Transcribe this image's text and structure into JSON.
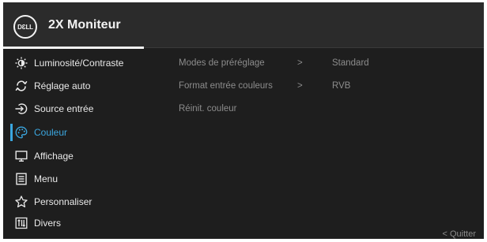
{
  "header": {
    "logo_text": "DƐLL",
    "title": "2X Moniteur"
  },
  "menu": {
    "items": [
      {
        "label": "Luminosité/Contraste",
        "icon": "brightness-icon"
      },
      {
        "label": "Réglage auto",
        "icon": "auto-adjust-icon"
      },
      {
        "label": "Source entrée",
        "icon": "input-source-icon"
      },
      {
        "label": "Couleur",
        "icon": "color-palette-icon",
        "selected": true
      },
      {
        "label": "Affichage",
        "icon": "display-icon"
      },
      {
        "label": "Menu",
        "icon": "menu-icon"
      },
      {
        "label": "Personnaliser",
        "icon": "star-icon"
      },
      {
        "label": "Divers",
        "icon": "others-icon"
      }
    ]
  },
  "submenu": {
    "rows": [
      {
        "label": "Modes de préréglage",
        "chevron": ">",
        "value": "Standard"
      },
      {
        "label": "Format entrée couleurs",
        "chevron": ">",
        "value": "RVB"
      },
      {
        "label": "Réinit. couleur",
        "chevron": "",
        "value": ""
      }
    ]
  },
  "footer": {
    "quit_label": "< Quitter"
  },
  "colors": {
    "background": "#1e1e1e",
    "header": "#2b2b2b",
    "text": "#e9e9e9",
    "accent": "#3ba7e0",
    "muted": "#8c8c8c"
  }
}
